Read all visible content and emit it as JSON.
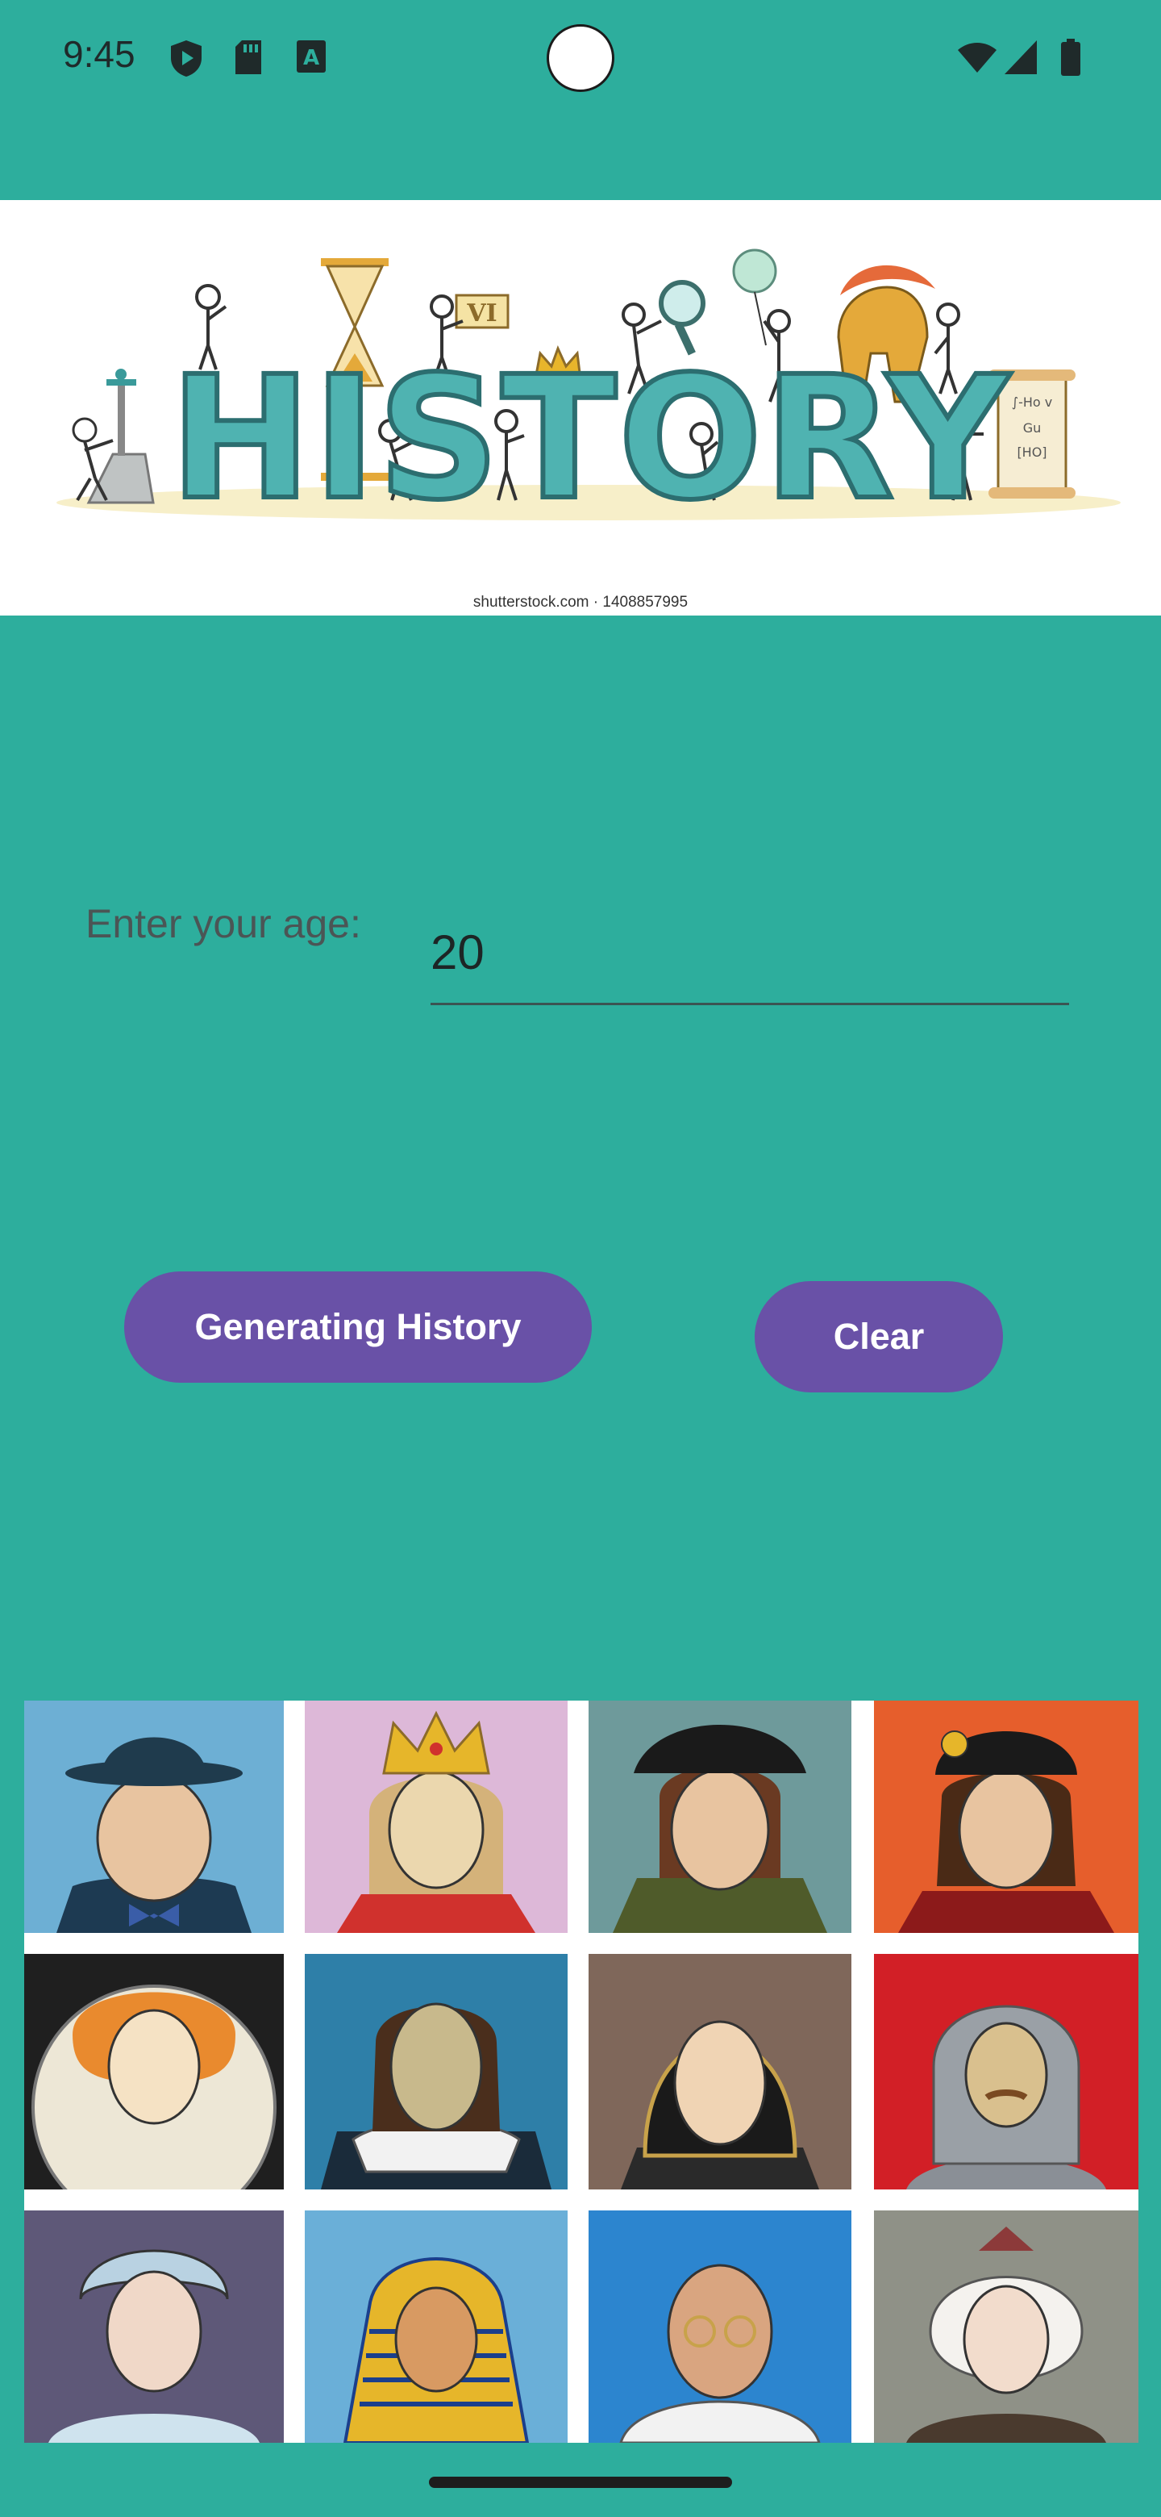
{
  "status_bar": {
    "time": "9:45",
    "icons_left": [
      "shield-play-icon",
      "sd-card-icon",
      "keyboard-a-icon"
    ],
    "icons_right": [
      "wifi-icon",
      "cell-signal-icon",
      "battery-icon"
    ]
  },
  "banner": {
    "title": "HISTORY",
    "credit": "shutterstock.com · 1408857995",
    "numeral": "VI"
  },
  "form": {
    "age_label": "Enter your age:",
    "age_value": "20"
  },
  "buttons": {
    "generate_label": "Generating History",
    "clear_label": "Clear"
  },
  "portraits": [
    {
      "name": "portrait-hat-statesman",
      "bg": "#6DAFD4"
    },
    {
      "name": "portrait-crowned-queen",
      "bg": "#DDB8D8"
    },
    {
      "name": "portrait-tudor-cap",
      "bg": "#6E9A9B"
    },
    {
      "name": "portrait-jeweled-cap",
      "bg": "#E65E2C"
    },
    {
      "name": "portrait-elizabeth",
      "bg": "#1f1f1f"
    },
    {
      "name": "portrait-shakespeare",
      "bg": "#2E7FA8"
    },
    {
      "name": "portrait-hooded-queen",
      "bg": "#7F675A"
    },
    {
      "name": "portrait-knight-chainmail",
      "bg": "#D21F26"
    },
    {
      "name": "portrait-bonnet-lady",
      "bg": "#5E5878"
    },
    {
      "name": "portrait-pharaoh",
      "bg": "#6AAFD8"
    },
    {
      "name": "portrait-gandhi",
      "bg": "#2C85CF"
    },
    {
      "name": "portrait-white-hair-queen",
      "bg": "#8F9187"
    }
  ]
}
